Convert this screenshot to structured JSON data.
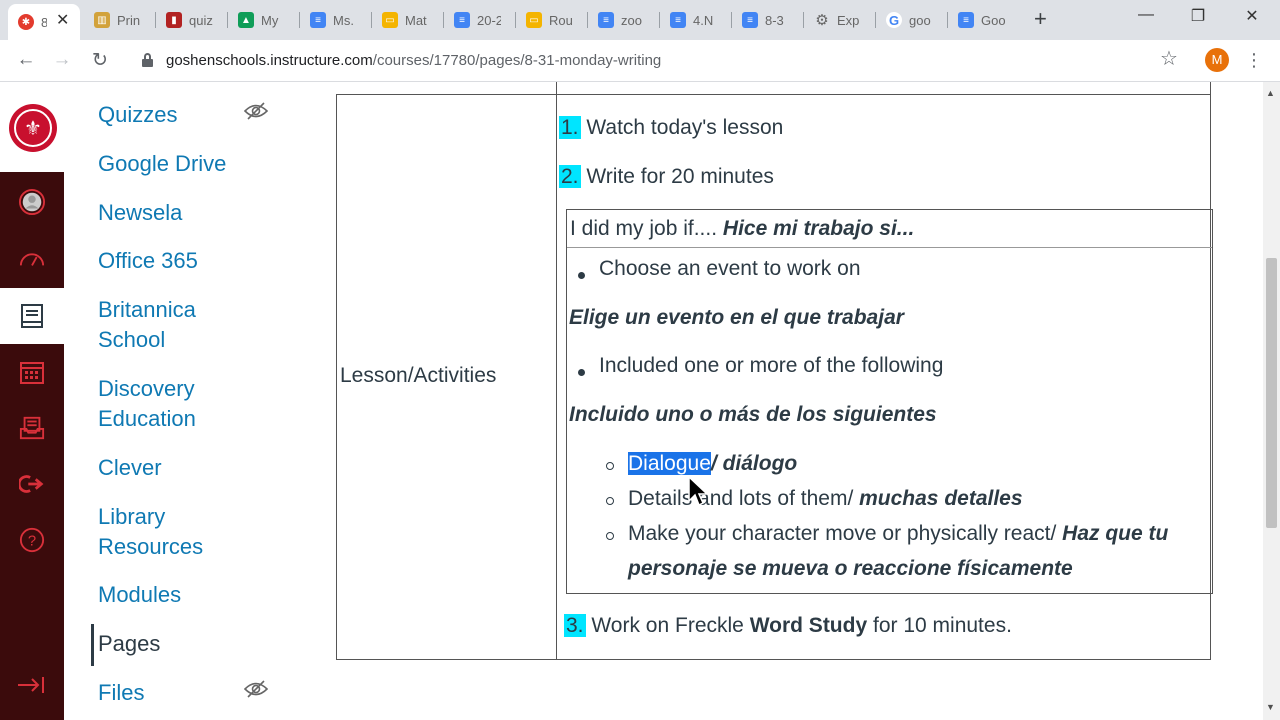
{
  "browser": {
    "tabs": [
      {
        "title": "8",
        "icon": "canvas-icon",
        "color": "#e33b2e",
        "active": true
      },
      {
        "title": "Prin",
        "icon": "library-icon",
        "color": "#d2a23b"
      },
      {
        "title": "quiz",
        "icon": "sheets-chart-icon",
        "color": "#b22222"
      },
      {
        "title": "My",
        "icon": "drive-icon",
        "color": "#0f9d58"
      },
      {
        "title": "Ms.",
        "icon": "docs-icon",
        "color": "#4285f4"
      },
      {
        "title": "Mat",
        "icon": "slides-icon",
        "color": "#f4b400"
      },
      {
        "title": "20-2",
        "icon": "docs-icon",
        "color": "#4285f4"
      },
      {
        "title": "Rou",
        "icon": "slides-icon",
        "color": "#f4b400"
      },
      {
        "title": "zoo",
        "icon": "docs-icon",
        "color": "#4285f4"
      },
      {
        "title": "4.N",
        "icon": "docs-icon",
        "color": "#4285f4"
      },
      {
        "title": "8-3",
        "icon": "docs-icon",
        "color": "#4285f4"
      },
      {
        "title": "Exp",
        "icon": "gear-icon",
        "color": "#888888"
      },
      {
        "title": "goo",
        "icon": "google-icon",
        "color": "#4285f4"
      },
      {
        "title": "Goo",
        "icon": "docs-icon",
        "color": "#4285f4"
      }
    ],
    "url_host": "goshenschools.instructure.com",
    "url_path": "/courses/17780/pages/8-31-monday-writing",
    "profile_initial": "M"
  },
  "course_nav": {
    "items": [
      {
        "label": "Quizzes",
        "hidden": true
      },
      {
        "label": "Google Drive"
      },
      {
        "label": "Newsela"
      },
      {
        "label": "Office 365"
      },
      {
        "label": "Britannica School"
      },
      {
        "label": "Discovery Education"
      },
      {
        "label": "Clever"
      },
      {
        "label": "Library Resources"
      },
      {
        "label": "Modules"
      },
      {
        "label": "Pages",
        "active": true
      },
      {
        "label": "Files",
        "hidden": true
      }
    ]
  },
  "content": {
    "row_label": "Lesson/Activities",
    "step1_num": "1.",
    "step1_text": "Watch today's lesson",
    "step2_num": "2.",
    "step2_text": "Write for 20 minutes",
    "criteria_en": "I did my job if....",
    "criteria_es": "Hice mi trabajo si...",
    "bullet1": "Choose an event to work on",
    "bullet1_es": "Elige un evento en el que trabajar",
    "bullet2": "Included one or more of the following",
    "bullet2_es": "Incluido uno o más de los siguientes",
    "sub1_en": "Dialogue",
    "sub1_es": "/ diálogo",
    "sub2_en": "Details and lots of them/",
    "sub2_es": "muchas detalles",
    "sub3_en": "Make your character move or physically react/",
    "sub3_es_line1": "Haz que tu",
    "sub3_es_line2": "personaje se mueva o reaccione físicamente",
    "step3_num": "3.",
    "step3_pre": "Work on Freckle",
    "step3_bold": "Word Study",
    "step3_post": "for 10 minutes.",
    "highlight_color": "#00e5ff",
    "selection_color": "#1a73e8"
  },
  "theme": {
    "gnav_bg": "#3b0b0c",
    "gnav_icon": "#d9303a",
    "link_color": "#0f79b3"
  }
}
